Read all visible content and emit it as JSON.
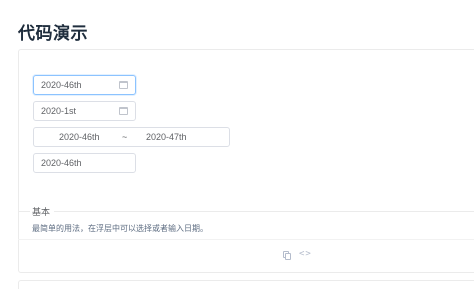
{
  "page": {
    "title": "代码演示"
  },
  "pickers": {
    "week": {
      "value": "2020-46th",
      "icon": "calendar-icon"
    },
    "quarter": {
      "value": "2020-1st",
      "icon": "calendar-icon"
    },
    "range": {
      "start": "2020-46th",
      "separator": "~",
      "end": "2020-47th"
    },
    "plain": {
      "value": "2020-46th"
    }
  },
  "section": {
    "title": "基本",
    "description": "最简单的用法，在浮层中可以选择或者输入日期。"
  },
  "actions": {
    "copy_icon": "copy-icon",
    "code_icon": "code-icon",
    "code_glyph": "<>"
  }
}
